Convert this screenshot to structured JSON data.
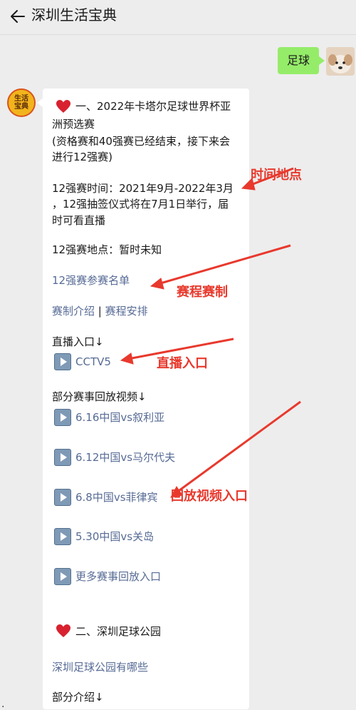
{
  "header": {
    "title": "深圳生活宝典"
  },
  "user_message": "足球",
  "bot_avatar_text": "生活\n宝典",
  "content": {
    "section1_title": "一、2022年卡塔尔足球世界杯亚",
    "section1_line2": "洲预选赛",
    "section1_line3": "(资格赛和40强赛已经结束，接下来会",
    "section1_line4": "进行12强赛)",
    "time_line1": "12强赛时间：2021年9月-2022年3月",
    "time_line2": "，12强抽签仪式将在7月1日举行，届",
    "time_line3": "时可看直播",
    "venue": "12强赛地点：暂时未知",
    "roster_link": "12强赛参赛名单",
    "rules_link": "赛制介绍",
    "separator": " | ",
    "schedule_link": "赛程安排",
    "live_heading": "直播入口↓",
    "cctv5": "CCTV5",
    "replay_heading": "部分赛事回放视频↓",
    "replays": [
      "6.16中国vs叙利亚",
      "6.12中国vs马尔代夫",
      "6.8中国vs菲律宾",
      "5.30中国vs关岛",
      "更多赛事回放入口"
    ],
    "section2_title": "二、深圳足球公园",
    "parks_link": "深圳足球公园有哪些",
    "intro_heading": "部分介绍↓"
  },
  "annotations": {
    "time_place": "时间地点",
    "schedule_format": "赛程赛制",
    "live_entry": "直播入口",
    "replay_entry": "回放视频入口"
  },
  "footer_dot": "."
}
